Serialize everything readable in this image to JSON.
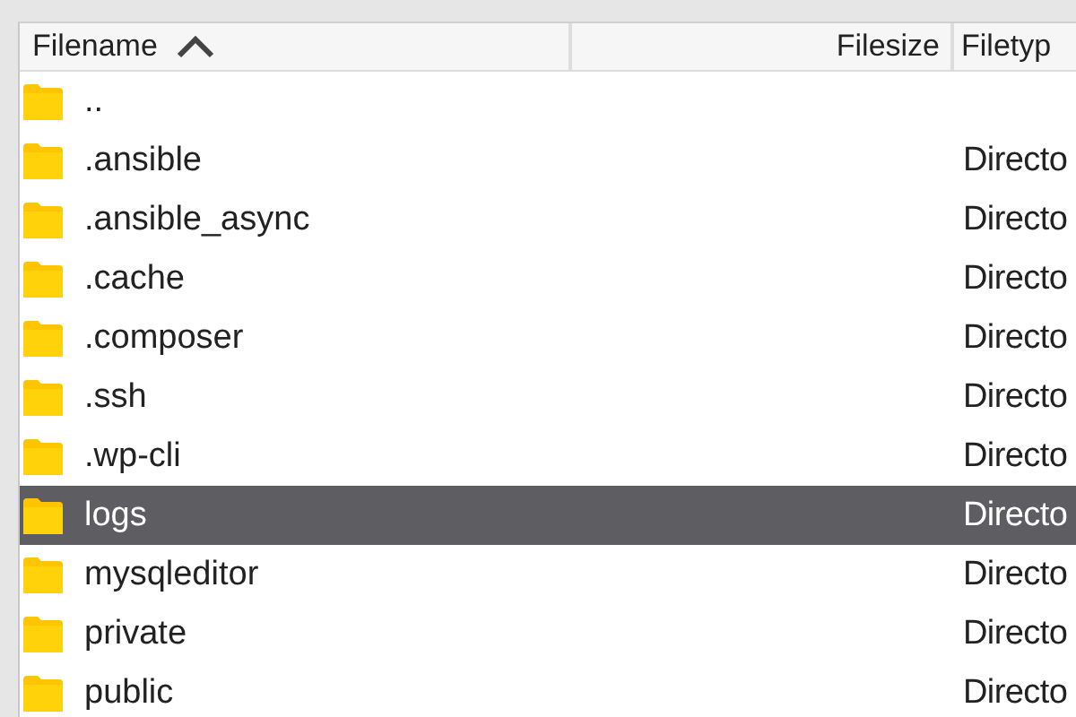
{
  "table": {
    "columns": [
      {
        "label": "Filename",
        "sorted": true
      },
      {
        "label": "Filesize",
        "sorted": false
      },
      {
        "label": "Filetyp",
        "sorted": false
      }
    ],
    "rows": [
      {
        "name": "..",
        "type": "",
        "selected": false
      },
      {
        "name": ".ansible",
        "type": "Directo",
        "selected": false
      },
      {
        "name": ".ansible_async",
        "type": "Directo",
        "selected": false
      },
      {
        "name": ".cache",
        "type": "Directo",
        "selected": false
      },
      {
        "name": ".composer",
        "type": "Directo",
        "selected": false
      },
      {
        "name": ".ssh",
        "type": "Directo",
        "selected": false
      },
      {
        "name": ".wp-cli",
        "type": "Directo",
        "selected": false
      },
      {
        "name": "logs",
        "type": "Directo",
        "selected": true
      },
      {
        "name": "mysqleditor",
        "type": "Directo",
        "selected": false
      },
      {
        "name": "private",
        "type": "Directo",
        "selected": false
      },
      {
        "name": "public",
        "type": "Directo",
        "selected": false
      }
    ]
  }
}
